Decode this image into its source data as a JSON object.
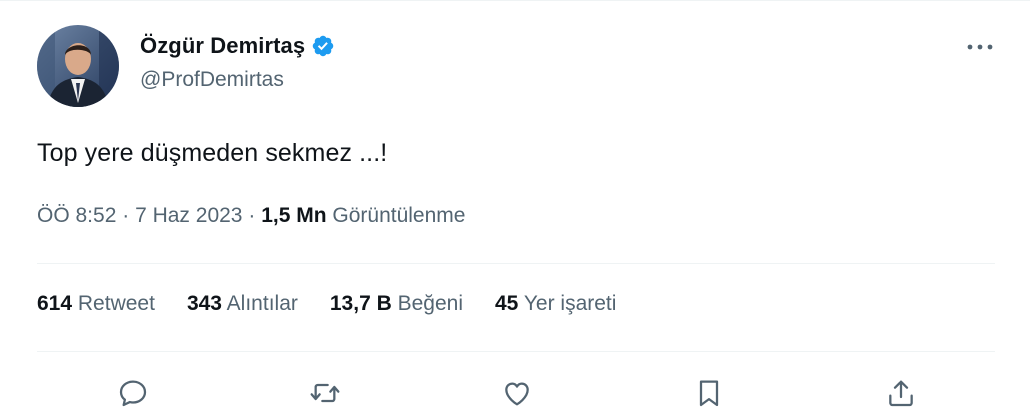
{
  "author": {
    "display_name": "Özgür Demirtaş",
    "handle": "@ProfDemirtas",
    "verified_icon": "verified-badge-icon",
    "verified_color": "#1d9bf0"
  },
  "tweet": {
    "text": "Top yere düşmeden sekmez ...!",
    "time": "ÖÖ 8:52",
    "separator": "·",
    "date": "7 Haz 2023",
    "views_count": "1,5 Mn",
    "views_label": "Görüntülenme"
  },
  "stats": {
    "retweets": {
      "count": "614",
      "label": "Retweet"
    },
    "quotes": {
      "count": "343",
      "label": "Alıntılar"
    },
    "likes": {
      "count": "13,7 B",
      "label": "Beğeni"
    },
    "bookmarks": {
      "count": "45",
      "label": "Yer işareti"
    }
  },
  "actions": {
    "icons": [
      "reply-icon",
      "retweet-icon",
      "like-icon",
      "bookmark-icon",
      "share-icon"
    ],
    "icon_color": "#536471"
  },
  "colors": {
    "text_primary": "#0f1419",
    "text_secondary": "#536471",
    "divider": "#eff3f4"
  }
}
